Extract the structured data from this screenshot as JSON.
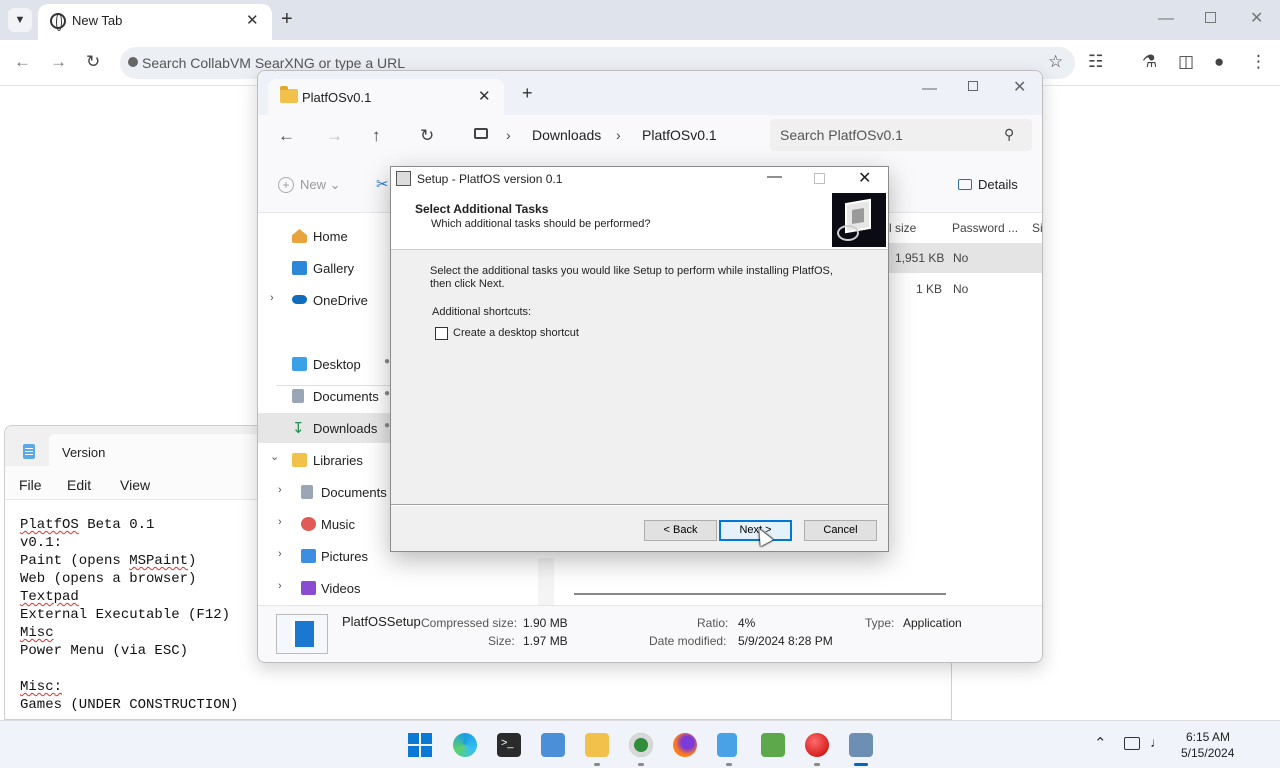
{
  "browser": {
    "tab_title": "New Tab",
    "omnibox_placeholder": "Search CollabVM SearXNG or type a URL"
  },
  "notepad": {
    "tab_title": "Version",
    "menu": [
      "File",
      "Edit",
      "View"
    ],
    "lines": [
      "PlatfOS Beta 0.1",
      "v0.1:",
      "Paint (opens MSPaint)",
      "Web (opens a browser)",
      "Textpad",
      "External Executable (F12)",
      "Misc",
      "Power Menu (via ESC)",
      "",
      "Misc:",
      "Games (UNDER CONSTRUCTION)"
    ]
  },
  "explorer": {
    "tab_title": "PlatfOSv0.1",
    "breadcrumb": [
      "Downloads",
      "PlatfOSv0.1"
    ],
    "search_placeholder": "Search PlatfOSv0.1",
    "toolbar": {
      "new_label": "New",
      "details_label": "Details"
    },
    "nav": [
      {
        "label": "Home",
        "icon": "home-icon"
      },
      {
        "label": "Gallery",
        "icon": "gallery-icon"
      },
      {
        "label": "OneDrive",
        "icon": "cloud-icon"
      },
      {
        "label": "Desktop",
        "icon": "desktop-icon"
      },
      {
        "label": "Documents",
        "icon": "documents-icon"
      },
      {
        "label": "Downloads",
        "icon": "downloads-icon"
      },
      {
        "label": "Libraries",
        "icon": "libraries-icon"
      },
      {
        "label": "Documents",
        "icon": "documents-icon"
      },
      {
        "label": "Music",
        "icon": "music-icon"
      },
      {
        "label": "Pictures",
        "icon": "pictures-icon"
      },
      {
        "label": "Videos",
        "icon": "videos-icon"
      }
    ],
    "columns": {
      "size": "l size",
      "password": "Password ...",
      "si": "Si"
    },
    "rows": [
      {
        "size": "1,951 KB",
        "password": "No"
      },
      {
        "size": "1 KB",
        "password": "No"
      }
    ],
    "details_pane": {
      "name": "PlatfOSSetup",
      "compressed_size_label": "Compressed size:",
      "compressed_size": "1.90 MB",
      "size_label": "Size:",
      "size": "1.97 MB",
      "ratio_label": "Ratio:",
      "ratio": "4%",
      "date_modified_label": "Date modified:",
      "date_modified": "5/9/2024 8:28 PM",
      "type_label": "Type:",
      "type": "Application"
    }
  },
  "setup": {
    "window_title": "Setup - PlatfOS version 0.1",
    "header_title": "Select Additional Tasks",
    "header_subtitle": "Which additional tasks should be performed?",
    "body_line1": "Select the additional tasks you would like Setup to perform while installing PlatfOS,",
    "body_line2": "then click Next.",
    "shortcuts_label": "Additional shortcuts:",
    "checkbox_label": "Create a desktop shortcut",
    "back_label": "< Back",
    "next_label": "Next >",
    "cancel_label": "Cancel"
  },
  "taskbar": {
    "time": "6:15 AM",
    "date": "5/15/2024"
  },
  "colors": {
    "accent": "#0078d7",
    "taskbar_bg": "#f0f3f9"
  }
}
